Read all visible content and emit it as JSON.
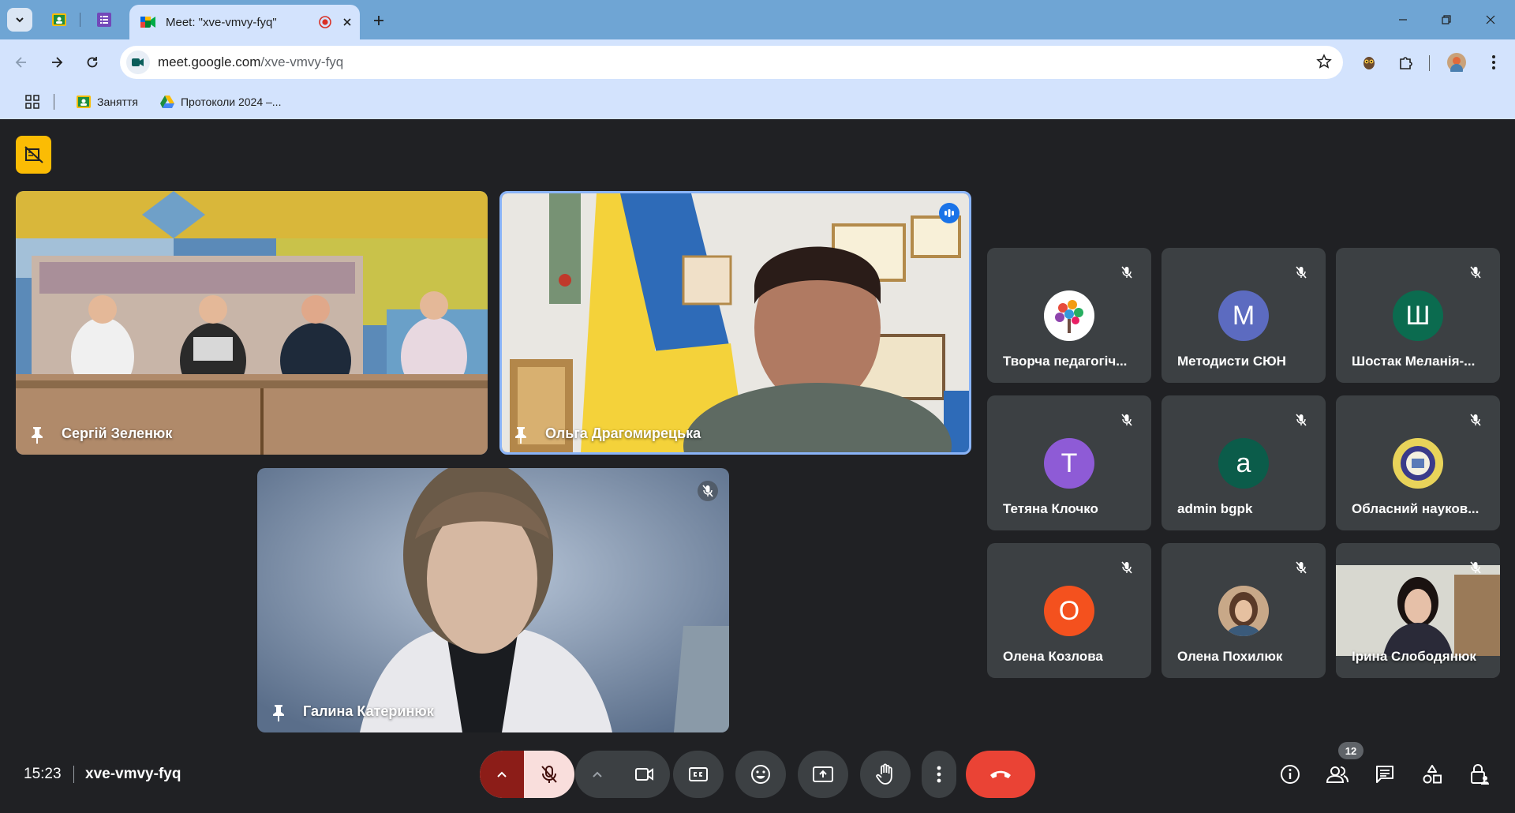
{
  "browser": {
    "tab_title": "Meet: \"xve-vmvy-fyq\"",
    "url_host": "meet.google.com",
    "url_path": "/xve-vmvy-fyq",
    "bookmarks": [
      {
        "label": "Заняття",
        "icon": "classroom-icon"
      },
      {
        "label": "Протоколи 2024 –...",
        "icon": "drive-icon"
      }
    ]
  },
  "meeting": {
    "time": "15:23",
    "code": "xve-vmvy-fyq",
    "participant_count": "12",
    "video_tiles": [
      {
        "name": "Сергій Зеленюк"
      },
      {
        "name": "Ольга Драгомирецька"
      },
      {
        "name": "Галина Катеринюк"
      }
    ],
    "small_tiles": [
      {
        "name": "Творча педагогіч...",
        "initial": "",
        "color": "#ffffff"
      },
      {
        "name": "Методисти СЮН",
        "initial": "М",
        "color": "#5c6bc0"
      },
      {
        "name": "Шостак Меланія-...",
        "initial": "Ш",
        "color": "#0b6b4f"
      },
      {
        "name": "Тетяна Клочко",
        "initial": "Т",
        "color": "#8e5bd6"
      },
      {
        "name": "admin bgpk",
        "initial": "a",
        "color": "#0b5c4a"
      },
      {
        "name": "Обласний науков...",
        "initial": "",
        "color": "#e8d35a"
      },
      {
        "name": "Олена Козлова",
        "initial": "О",
        "color": "#f4511e"
      },
      {
        "name": "Олена Похилюк",
        "initial": "",
        "color": "#8a6a55"
      },
      {
        "name": "Ірина Слободянюк",
        "initial": "",
        "color": "#7b8a8a"
      }
    ]
  },
  "colors": {
    "meet_bg": "#202124",
    "tile_bg": "#3c4043",
    "end_call": "#ea4335",
    "mic_muted": "#f9dedc",
    "active_speaker_border": "#8ab4f8"
  }
}
